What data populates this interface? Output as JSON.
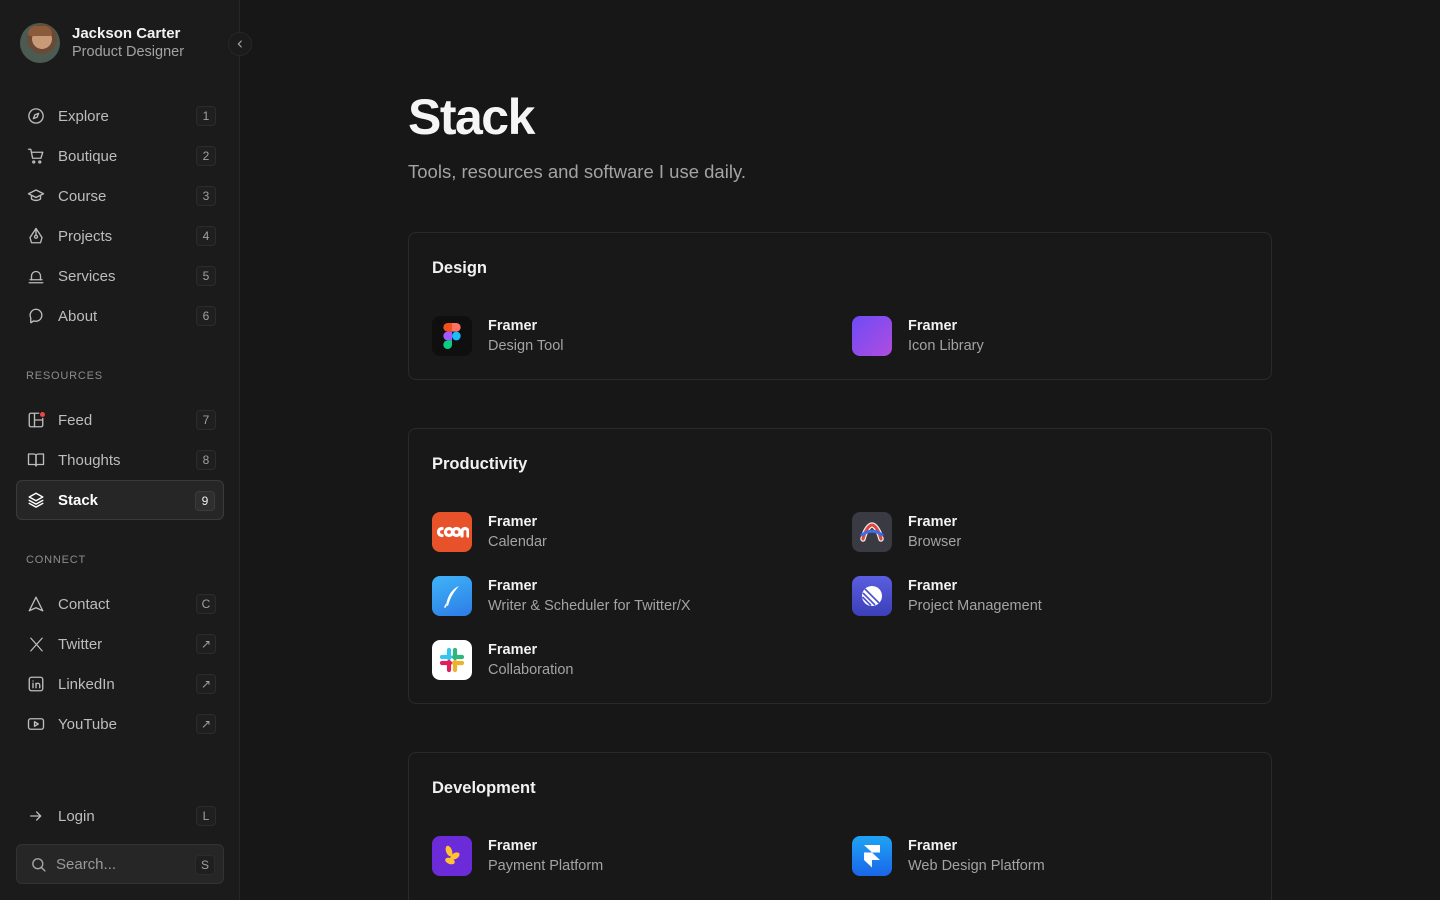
{
  "profile": {
    "name": "Jackson Carter",
    "role": "Product Designer"
  },
  "nav": {
    "main": [
      {
        "label": "Explore",
        "key": "1",
        "icon": "compass-icon"
      },
      {
        "label": "Boutique",
        "key": "2",
        "icon": "cart-icon"
      },
      {
        "label": "Course",
        "key": "3",
        "icon": "graduation-cap-icon"
      },
      {
        "label": "Projects",
        "key": "4",
        "icon": "pen-tool-icon"
      },
      {
        "label": "Services",
        "key": "5",
        "icon": "bell-icon"
      },
      {
        "label": "About",
        "key": "6",
        "icon": "chat-bubble-icon"
      }
    ],
    "resources_title": "RESOURCES",
    "resources": [
      {
        "label": "Feed",
        "key": "7",
        "icon": "layout-icon"
      },
      {
        "label": "Thoughts",
        "key": "8",
        "icon": "book-icon"
      },
      {
        "label": "Stack",
        "key": "9",
        "icon": "layers-icon",
        "active": true
      }
    ],
    "connect_title": "CONNECT",
    "connect": [
      {
        "label": "Contact",
        "key": "C",
        "icon": "send-icon"
      },
      {
        "label": "Twitter",
        "key": "↗",
        "icon": "x-logo-icon"
      },
      {
        "label": "LinkedIn",
        "key": "↗",
        "icon": "linkedin-icon"
      },
      {
        "label": "YouTube",
        "key": "↗",
        "icon": "youtube-icon"
      }
    ],
    "login": {
      "label": "Login",
      "key": "L"
    },
    "search": {
      "placeholder": "Search...",
      "key": "S"
    }
  },
  "page": {
    "title": "Stack",
    "subtitle": "Tools, resources and software I use daily."
  },
  "sections": [
    {
      "title": "Design",
      "tools": [
        {
          "name": "Framer",
          "desc": "Design Tool",
          "icon": "figma-icon"
        },
        {
          "name": "Framer",
          "desc": "Icon Library",
          "icon": "gradient-square-icon"
        }
      ]
    },
    {
      "title": "Productivity",
      "tools": [
        {
          "name": "Framer",
          "desc": "Calendar",
          "icon": "cron-icon"
        },
        {
          "name": "Framer",
          "desc": "Browser",
          "icon": "arc-icon"
        },
        {
          "name": "Framer",
          "desc": "Writer & Scheduler for Twitter/X",
          "icon": "quill-icon"
        },
        {
          "name": "Framer",
          "desc": "Project Management",
          "icon": "linear-icon"
        },
        {
          "name": "Framer",
          "desc": "Collaboration",
          "icon": "slack-icon"
        }
      ]
    },
    {
      "title": "Development",
      "tools": [
        {
          "name": "Framer",
          "desc": "Payment Platform",
          "icon": "lemon-squeezy-icon"
        },
        {
          "name": "Framer",
          "desc": "Web Design Platform",
          "icon": "framer-icon"
        }
      ]
    }
  ],
  "colors": {
    "background": "#171717",
    "sidebar": "#1b1b1b",
    "accent_red": "#ef4444"
  }
}
